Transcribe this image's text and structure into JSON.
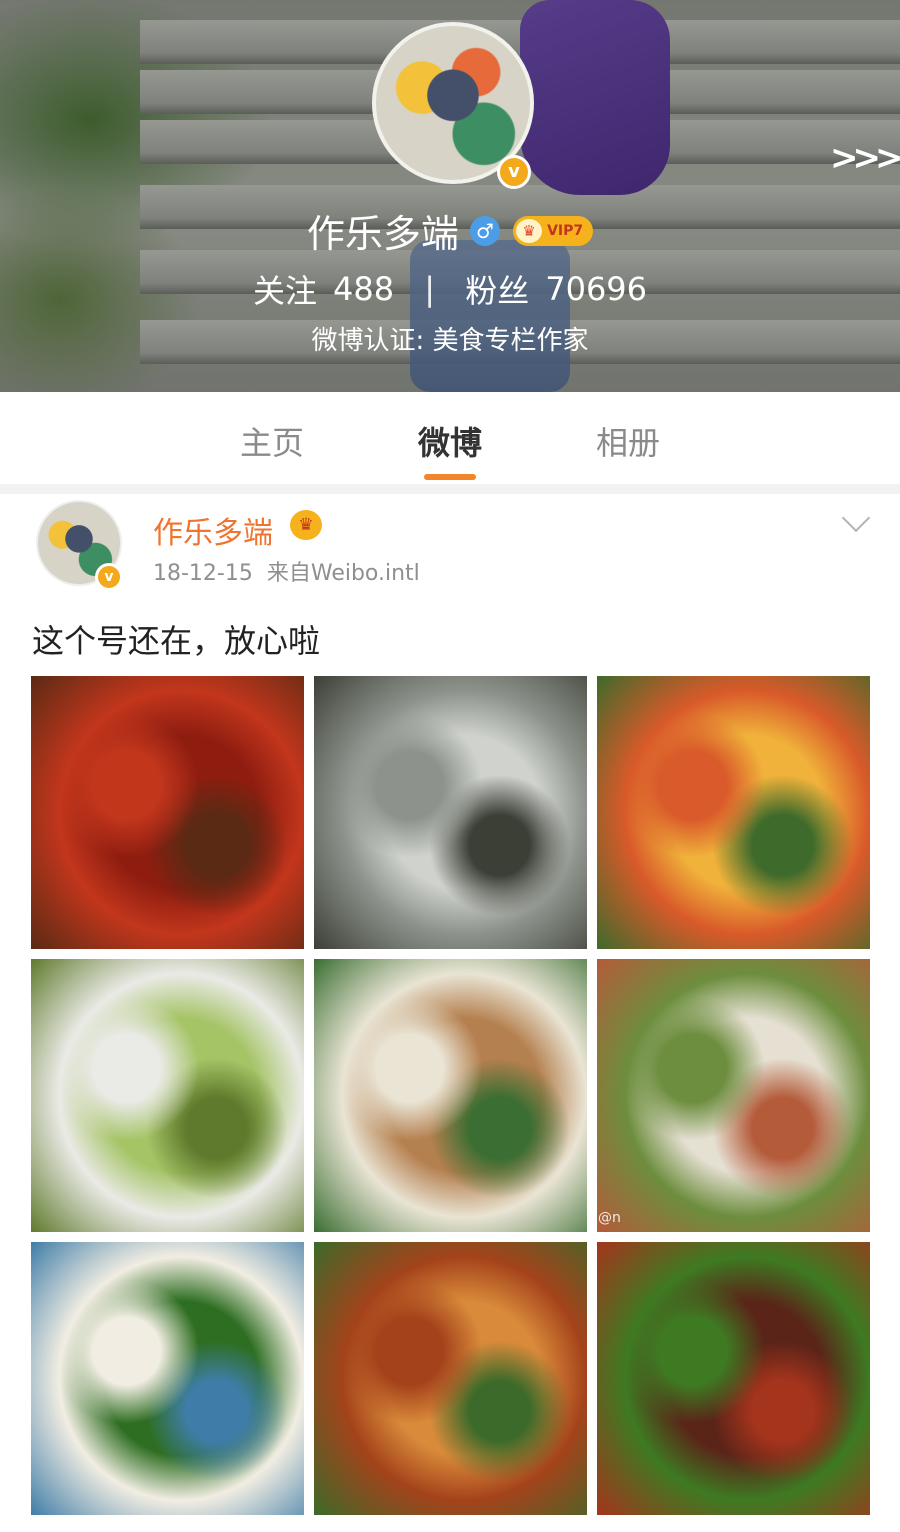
{
  "profile": {
    "name": "作乐多端",
    "vip_label": "VIP7",
    "follow_label": "关注",
    "follow_count": "488",
    "stats_separator": "|",
    "fans_label": "粉丝",
    "fans_count": "70696",
    "verification": "微博认证: 美食专栏作家",
    "icons": [
      "verified-icon",
      "male-icon",
      "vip-crown-icon",
      "next-arrows-icon"
    ]
  },
  "tabs": [
    {
      "label": "主页",
      "active": false
    },
    {
      "label": "微博",
      "active": true
    },
    {
      "label": "相册",
      "active": false
    }
  ],
  "post": {
    "author": "作乐多端",
    "date": "18-12-15",
    "source": "来自Weibo.intl",
    "text": "这个号还在，放心啦",
    "photo_watermark": "@n",
    "photos": [
      {
        "name": "spicy-chicken-photo",
        "colors": [
          "#8e1d10",
          "#c2361c",
          "#5a2a14"
        ]
      },
      {
        "name": "mushroom-soup-photo",
        "colors": [
          "#cfd2cd",
          "#8d938c",
          "#3c3f36"
        ]
      },
      {
        "name": "egg-stirfry-photo",
        "colors": [
          "#f0b23a",
          "#d95a2a",
          "#3e6a2b"
        ]
      },
      {
        "name": "lettuce-photo",
        "colors": [
          "#a5c466",
          "#eaeae6",
          "#5f7a2c"
        ]
      },
      {
        "name": "radish-soup-photo",
        "colors": [
          "#b5804f",
          "#e9e4d4",
          "#3a6e32"
        ]
      },
      {
        "name": "tofu-fish-soup-photo",
        "colors": [
          "#e6e0d3",
          "#6d8e3e",
          "#b45b3a"
        ]
      },
      {
        "name": "broccoli-squid-photo",
        "colors": [
          "#2e6e22",
          "#f1ede2",
          "#3f7da8"
        ]
      },
      {
        "name": "fried-tofu-photo",
        "colors": [
          "#d98a3a",
          "#a4431b",
          "#3c6a2a"
        ]
      },
      {
        "name": "beef-celery-photo",
        "colors": [
          "#5a2418",
          "#3e7a22",
          "#a5341c"
        ]
      }
    ]
  }
}
